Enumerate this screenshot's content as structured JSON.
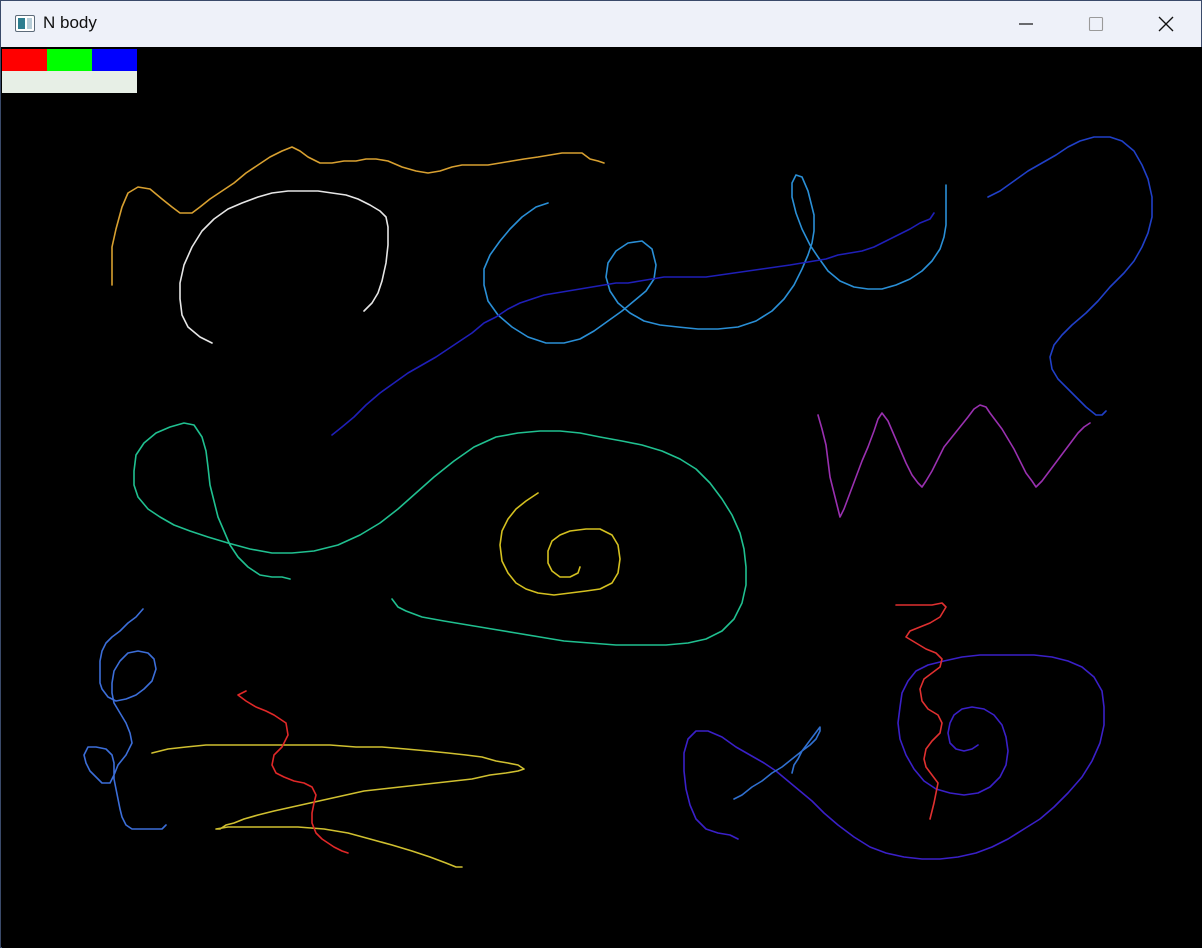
{
  "window": {
    "title": "N body"
  },
  "toolbar": {
    "swatches": [
      {
        "name": "red",
        "color": "#ff0000"
      },
      {
        "name": "green",
        "color": "#00ff00"
      },
      {
        "name": "blue",
        "color": "#0000ff"
      }
    ],
    "input_value": ""
  },
  "trails": [
    {
      "color": "#d8a030"
    },
    {
      "color": "#e6e6e6"
    },
    {
      "color": "#2a8fd6"
    },
    {
      "color": "#1f1fb8"
    },
    {
      "color": "#2040c8"
    },
    {
      "color": "#9a30b0"
    },
    {
      "color": "#20c090"
    },
    {
      "color": "#d4c020"
    },
    {
      "color": "#3c6ed8"
    },
    {
      "color": "#d0c030"
    },
    {
      "color": "#e02828"
    },
    {
      "color": "#3a20c8"
    },
    {
      "color": "#e03030"
    },
    {
      "color": "#3070d0"
    }
  ]
}
